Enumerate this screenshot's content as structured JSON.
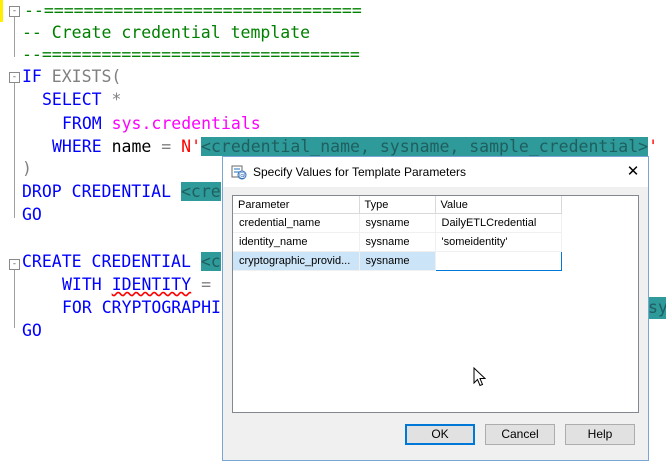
{
  "editor": {
    "lines": {
      "l0": "--================================",
      "l1": "-- Create credential template",
      "l2": "--================================",
      "l3_kw": "IF",
      "l3_gr": " EXISTS(",
      "l4_kw": "SELECT",
      "l4_gr": " *",
      "l5_kw": "FROM",
      "l5_pk": " sys.credentials",
      "l6_kw": "WHERE",
      "l6_tx": " name ",
      "l6_gr": "=",
      "l6_st": " N'",
      "l6_hl": "<credential_name, sysname, sample_credential>",
      "l6_end": "'",
      "l7": ")",
      "l8_kw": "DROP CREDENTIAL",
      "l8_hl": "<cre",
      "l9_kw": "GO",
      "l11_kw": "CREATE CREDENTIAL",
      "l11_hl": "<c",
      "l12_kw": "WITH",
      "l12_sq": "IDENTITY",
      "l12_gr": " =",
      "l13_kw": "FOR CRYPTOGRAPHI",
      "l13_hl": "sys",
      "l14_kw": "GO"
    }
  },
  "dialog": {
    "title": "Specify Values for Template Parameters",
    "close_glyph": "✕",
    "columns": [
      "Parameter",
      "Type",
      "Value"
    ],
    "rows": [
      {
        "parameter": "credential_name",
        "type": "sysname",
        "value": "DailyETLCredential"
      },
      {
        "parameter": "identity_name",
        "type": "sysname",
        "value": "'someidentity'"
      },
      {
        "parameter": "cryptographic_provid...",
        "type": "sysname",
        "value": ""
      }
    ],
    "buttons": {
      "ok": "OK",
      "cancel": "Cancel",
      "help": "Help"
    }
  },
  "colors": {
    "template_highlight": "#2e9a9a",
    "keyword": "#0000ff",
    "comment": "#008000",
    "selection": "#cce4f7",
    "focus_border": "#0078d7"
  },
  "icons": {
    "dialog_icon": "template-parameters-icon",
    "close": "close-icon",
    "cursor": "mouse-pointer-icon"
  }
}
